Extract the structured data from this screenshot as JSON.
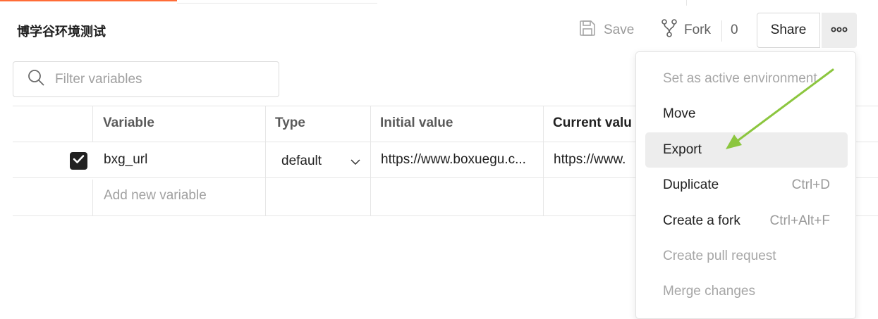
{
  "environment": {
    "title": "博学谷环境测试"
  },
  "toolbar": {
    "save_label": "Save",
    "fork_label": "Fork",
    "fork_count": "0",
    "share_label": "Share",
    "more_icon": "more-horizontal-icon"
  },
  "search": {
    "placeholder": "Filter variables",
    "value": ""
  },
  "table": {
    "headers": [
      "Variable",
      "Type",
      "Initial value",
      "Current valu"
    ],
    "rows": [
      {
        "enabled": true,
        "variable": "bxg_url",
        "type": "default",
        "initial_value": "https://www.boxuegu.c...",
        "current_value": "https://www."
      }
    ],
    "add_placeholder": "Add new variable"
  },
  "menu": {
    "items": [
      {
        "label": "Set as active environment",
        "shortcut": "",
        "enabled": false
      },
      {
        "label": "Move",
        "shortcut": "",
        "enabled": true
      },
      {
        "label": "Export",
        "shortcut": "",
        "enabled": true,
        "hovered": true
      },
      {
        "label": "Duplicate",
        "shortcut": "Ctrl+D",
        "enabled": true
      },
      {
        "label": "Create a fork",
        "shortcut": "Ctrl+Alt+F",
        "enabled": true
      },
      {
        "label": "Create pull request",
        "shortcut": "",
        "enabled": false
      },
      {
        "label": "Merge changes",
        "shortcut": "",
        "enabled": false
      }
    ]
  },
  "colors": {
    "accent": "#ff6c37",
    "annotation_arrow": "#8cc63f",
    "checkbox": "#212121",
    "menu_hover": "#ededed"
  }
}
